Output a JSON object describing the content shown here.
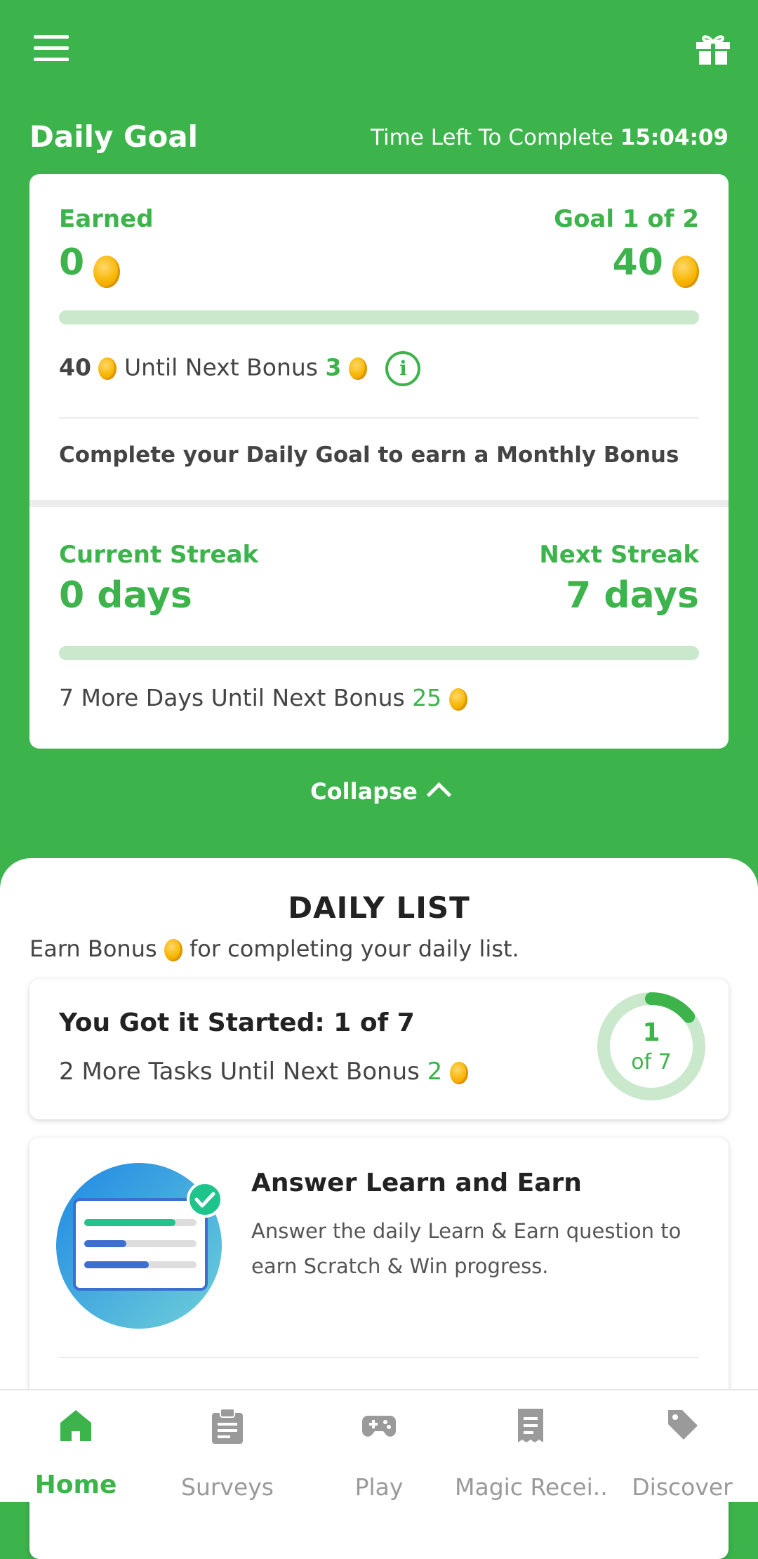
{
  "header": {
    "menu_icon": "hamburger-icon",
    "gift_icon": "gift-icon"
  },
  "daily_goal": {
    "title": "Daily Goal",
    "time_left_label": "Time Left To Complete",
    "time_left_value": "15:04:09",
    "earned_label": "Earned",
    "earned_value": "0",
    "goal_label": "Goal 1 of 2",
    "goal_value": "40",
    "progress_fraction": 0,
    "bonus_amount": "40",
    "bonus_text": "Until Next Bonus",
    "bonus_value": "3",
    "monthly_note": "Complete your Daily Goal to earn a Monthly Bonus",
    "current_streak_label": "Current Streak",
    "current_streak_value": "0 days",
    "next_streak_label": "Next Streak",
    "next_streak_value": "7 days",
    "streak_progress_fraction": 0,
    "streak_bonus_text": "7 More Days Until Next Bonus",
    "streak_bonus_value": "25",
    "collapse_label": "Collapse"
  },
  "daily_list": {
    "title": "DAILY LIST",
    "subtitle_pre": "Earn Bonus",
    "subtitle_post": "for completing your daily list.",
    "progress_card": {
      "title": "You Got it Started: 1 of 7",
      "subtitle": "2 More Tasks Until Next Bonus",
      "bonus_value": "2",
      "ring_value": "1",
      "ring_caption": "of 7",
      "ring_fraction": 0.1429
    },
    "task": {
      "title": "Answer Learn and Earn",
      "desc_line1": "Answer the daily Learn & Earn question to",
      "desc_line2": "earn Scratch & Win progress.",
      "completed": true
    }
  },
  "colors": {
    "brand_green": "#3cb44b",
    "light_green": "#c9e8cc",
    "coin": "#f7b500"
  },
  "bottom_nav": [
    {
      "label": "Home",
      "icon": "home-icon",
      "active": true
    },
    {
      "label": "Surveys",
      "icon": "clipboard-icon",
      "active": false
    },
    {
      "label": "Play",
      "icon": "gamepad-icon",
      "active": false
    },
    {
      "label": "Magic Recei...",
      "icon": "receipt-icon",
      "active": false
    },
    {
      "label": "Discover",
      "icon": "tag-icon",
      "active": false
    }
  ]
}
